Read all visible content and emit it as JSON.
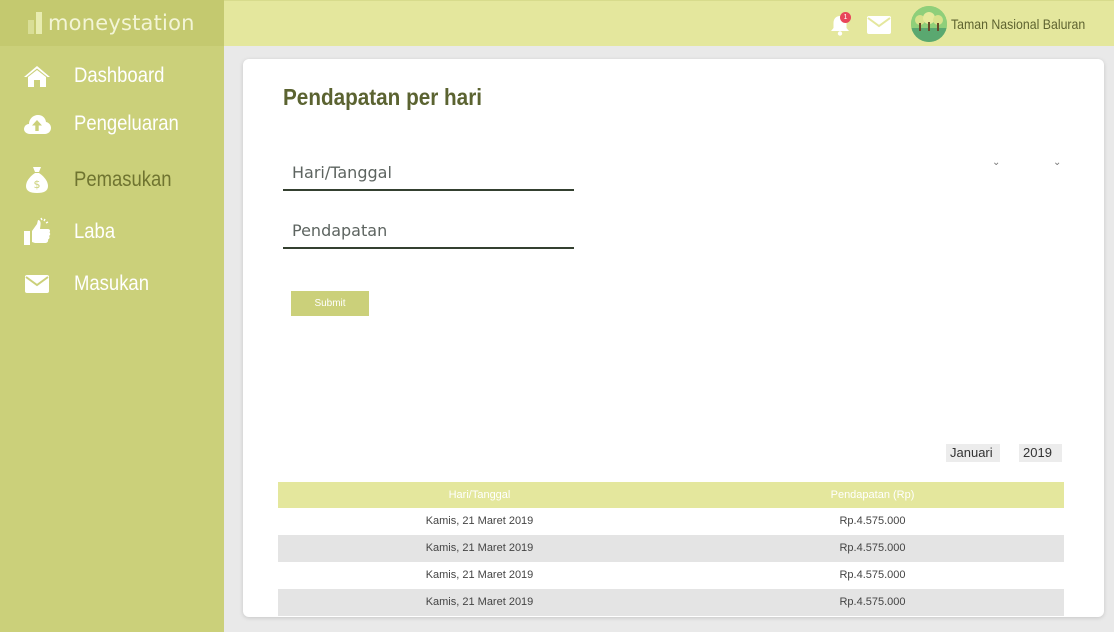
{
  "app": {
    "logo_text": "moneystation"
  },
  "sidebar": {
    "items": [
      {
        "label": "Dashboard",
        "icon": "home-icon"
      },
      {
        "label": "Pengeluaran",
        "icon": "cloud-upload-icon"
      },
      {
        "label": "Pemasukan",
        "icon": "money-bag-icon"
      },
      {
        "label": "Laba",
        "icon": "thumbs-up-icon"
      },
      {
        "label": "Masukan",
        "icon": "envelope-icon"
      }
    ]
  },
  "topbar": {
    "notification_count": "1",
    "user_name": "Taman Nasional Baluran"
  },
  "form": {
    "title": "Pendapatan per hari",
    "date_placeholder": "Hari/Tanggal",
    "income_placeholder": "Pendapatan",
    "submit_label": "Submit"
  },
  "filters": {
    "month": "Januari",
    "year": "2019"
  },
  "table": {
    "headers": [
      "Hari/Tanggal",
      "Pendapatan (Rp)"
    ],
    "rows": [
      [
        "Kamis, 21 Maret 2019",
        "Rp.4.575.000"
      ],
      [
        "Kamis, 21 Maret 2019",
        "Rp.4.575.000"
      ],
      [
        "Kamis, 21 Maret 2019",
        "Rp.4.575.000"
      ],
      [
        "Kamis, 21 Maret 2019",
        "Rp.4.575.000"
      ]
    ]
  },
  "colors": {
    "sidebar": "#cbd07a",
    "topbar": "#e4e79d",
    "title": "#5b6331",
    "badge": "#e8455a"
  }
}
